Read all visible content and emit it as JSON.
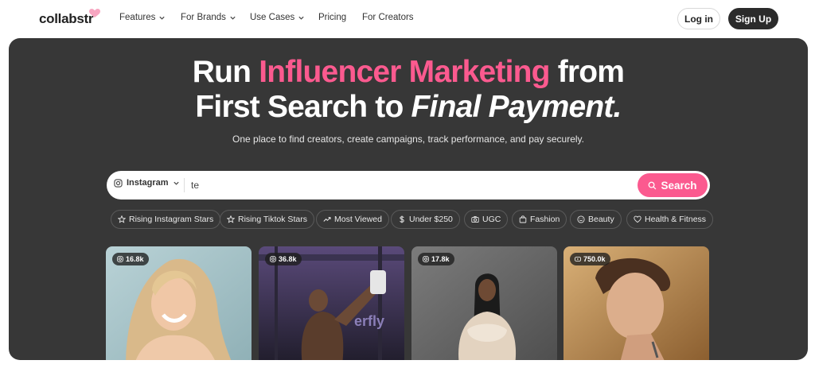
{
  "brand": {
    "name": "collabstr"
  },
  "nav": {
    "items": [
      {
        "label": "Features",
        "dropdown": true
      },
      {
        "label": "For Brands",
        "dropdown": true
      },
      {
        "label": "Use Cases",
        "dropdown": true
      },
      {
        "label": "Pricing",
        "dropdown": false
      },
      {
        "label": "For Creators",
        "dropdown": false
      }
    ],
    "login_label": "Log in",
    "signup_label": "Sign Up"
  },
  "hero": {
    "line1_a": "Run ",
    "line1_accent": "Influencer Marketing",
    "line1_b": " from",
    "line2_a": "First Search to ",
    "line2_italic": "Final Payment.",
    "subtitle": "One place to find creators, create campaigns, track performance, and pay securely."
  },
  "search": {
    "platform": "Instagram",
    "value": "te",
    "button_label": "Search"
  },
  "chips": [
    {
      "label": "Rising Instagram Stars",
      "icon": "star-icon"
    },
    {
      "label": "Rising Tiktok Stars",
      "icon": "star-icon"
    },
    {
      "label": "Most Viewed",
      "icon": "trending-icon"
    },
    {
      "label": "Under $250",
      "icon": "dollar-icon"
    },
    {
      "label": "UGC",
      "icon": "camera-icon"
    },
    {
      "label": "Fashion",
      "icon": "bag-icon"
    },
    {
      "label": "Beauty",
      "icon": "smile-icon"
    },
    {
      "label": "Health & Fitness",
      "icon": "heart-icon"
    }
  ],
  "cards": [
    {
      "followers": "16.8k",
      "platform_icon": "instagram-icon"
    },
    {
      "followers": "36.8k",
      "platform_icon": "instagram-icon"
    },
    {
      "followers": "17.8k",
      "platform_icon": "instagram-icon"
    },
    {
      "followers": "750.0k",
      "platform_icon": "youtube-icon"
    }
  ],
  "colors": {
    "accent": "#fb5a8f",
    "hero_bg": "#373737",
    "dark_button": "#2b2b2b"
  }
}
